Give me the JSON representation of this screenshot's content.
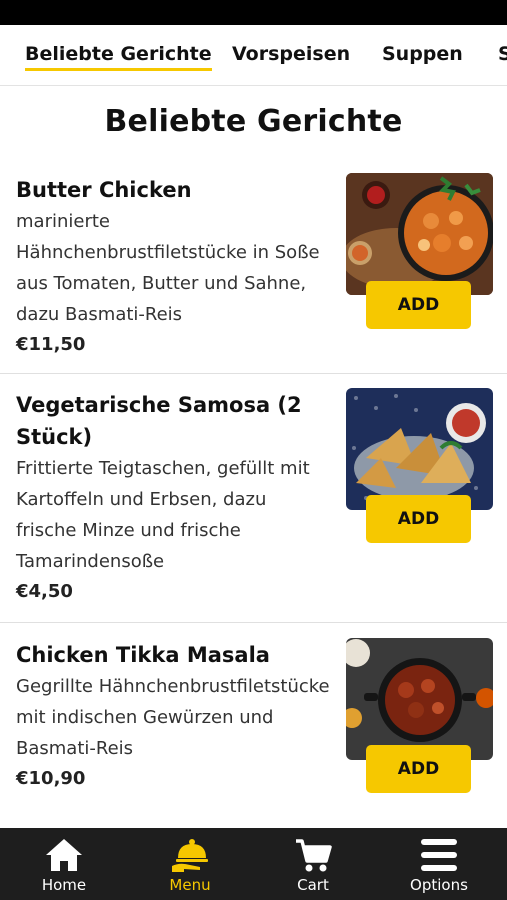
{
  "tabs": [
    {
      "label": "Beliebte Gerichte",
      "active": true
    },
    {
      "label": "Vorspeisen",
      "active": false
    },
    {
      "label": "Suppen",
      "active": false
    },
    {
      "label": "S",
      "active": false
    }
  ],
  "page_title": "Beliebte Gerichte",
  "items": [
    {
      "name": "Butter Chicken",
      "description": "marinierte Hähnchenbrustfiletstücke in Soße aus Tomaten, Butter und Sahne, dazu Basmati-Reis",
      "price": "€11,50",
      "add_label": "ADD"
    },
    {
      "name": "Vegetarische Samosa (2 Stück)",
      "description": "Frittierte Teigtaschen, gefüllt mit Kartoffeln und Erbsen, dazu frische Minze und frische Tamarindensoße",
      "price": "€4,50",
      "add_label": "ADD"
    },
    {
      "name": "Chicken Tikka Masala",
      "description": "Gegrillte Hähnchenbrustfiletstücke mit indischen Gewürzen und Basmati-Reis",
      "price": "€10,90",
      "add_label": "ADD"
    }
  ],
  "bottom_nav": [
    {
      "label": "Home",
      "icon": "home-icon",
      "active": false
    },
    {
      "label": "Menu",
      "icon": "serving-cloche-icon",
      "active": true
    },
    {
      "label": "Cart",
      "icon": "cart-icon",
      "active": false
    },
    {
      "label": "Options",
      "icon": "hamburger-menu-icon",
      "active": false
    }
  ],
  "colors": {
    "accent": "#f6c800",
    "nav_bg": "#1e1e1e",
    "text": "#111111"
  }
}
